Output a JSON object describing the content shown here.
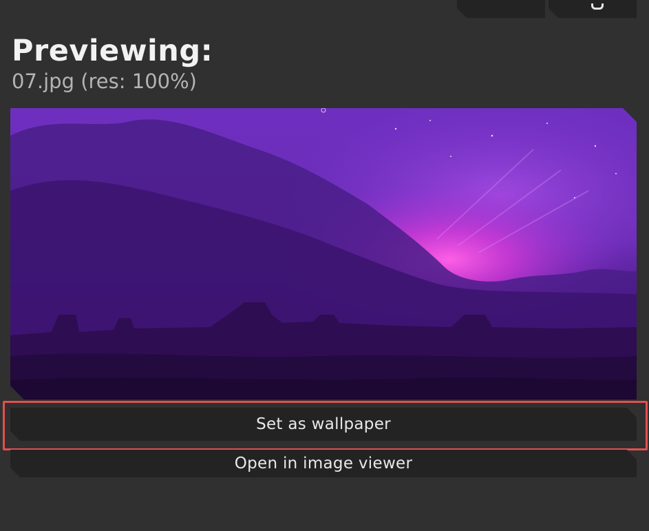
{
  "header": {
    "title": "Previewing:",
    "subtitle": "07.jpg (res: 100%)"
  },
  "top_buttons": [
    {
      "icon": "tab-icon"
    },
    {
      "icon": "g-glyph-icon"
    }
  ],
  "preview": {
    "file": "07.jpg"
  },
  "actions": {
    "set_wallpaper_label": "Set as wallpaper",
    "open_viewer_label": "Open in image viewer"
  },
  "colors": {
    "background": "#303030",
    "button_bg": "#232323",
    "highlight": "#e0514f",
    "sky_purple": "#6a2fb3",
    "glow_pink": "#f04ad6"
  }
}
